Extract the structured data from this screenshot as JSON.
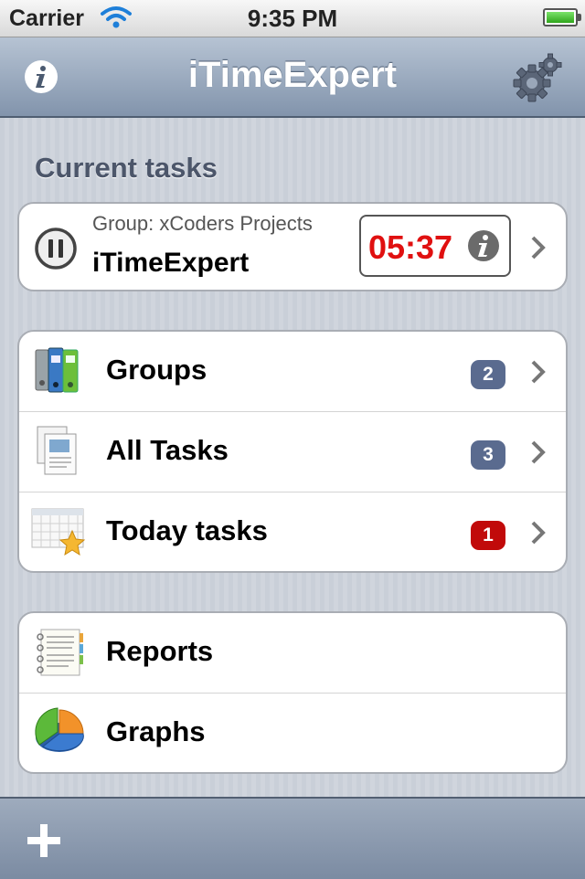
{
  "status_bar": {
    "carrier": "Carrier",
    "time": "9:35 PM"
  },
  "nav_bar": {
    "title": "iTimeExpert",
    "left_icon": "info-icon",
    "right_icon": "gear-icon"
  },
  "current_tasks": {
    "section_title": "Current tasks",
    "task": {
      "group_label": "Group: xCoders Projects",
      "name": "iTimeExpert",
      "timer": "05:37"
    }
  },
  "menu": {
    "items": [
      {
        "label": "Groups",
        "badge": "2",
        "badge_color": "#5a6b8f",
        "icon": "folders-icon"
      },
      {
        "label": "All Tasks",
        "badge": "3",
        "badge_color": "#5a6b8f",
        "icon": "documents-icon"
      },
      {
        "label": "Today tasks",
        "badge": "1",
        "badge_color": "#c10a0a",
        "icon": "calendar-star-icon"
      }
    ]
  },
  "reports": {
    "items": [
      {
        "label": "Reports",
        "icon": "notebook-icon"
      },
      {
        "label": "Graphs",
        "icon": "pie-chart-icon"
      }
    ]
  },
  "toolbar": {
    "add_icon": "plus-icon"
  },
  "colors": {
    "nav_bar": "#8294ac",
    "timer_text": "#e01010",
    "badge_blue": "#5a6b8f",
    "badge_red": "#c10a0a"
  }
}
